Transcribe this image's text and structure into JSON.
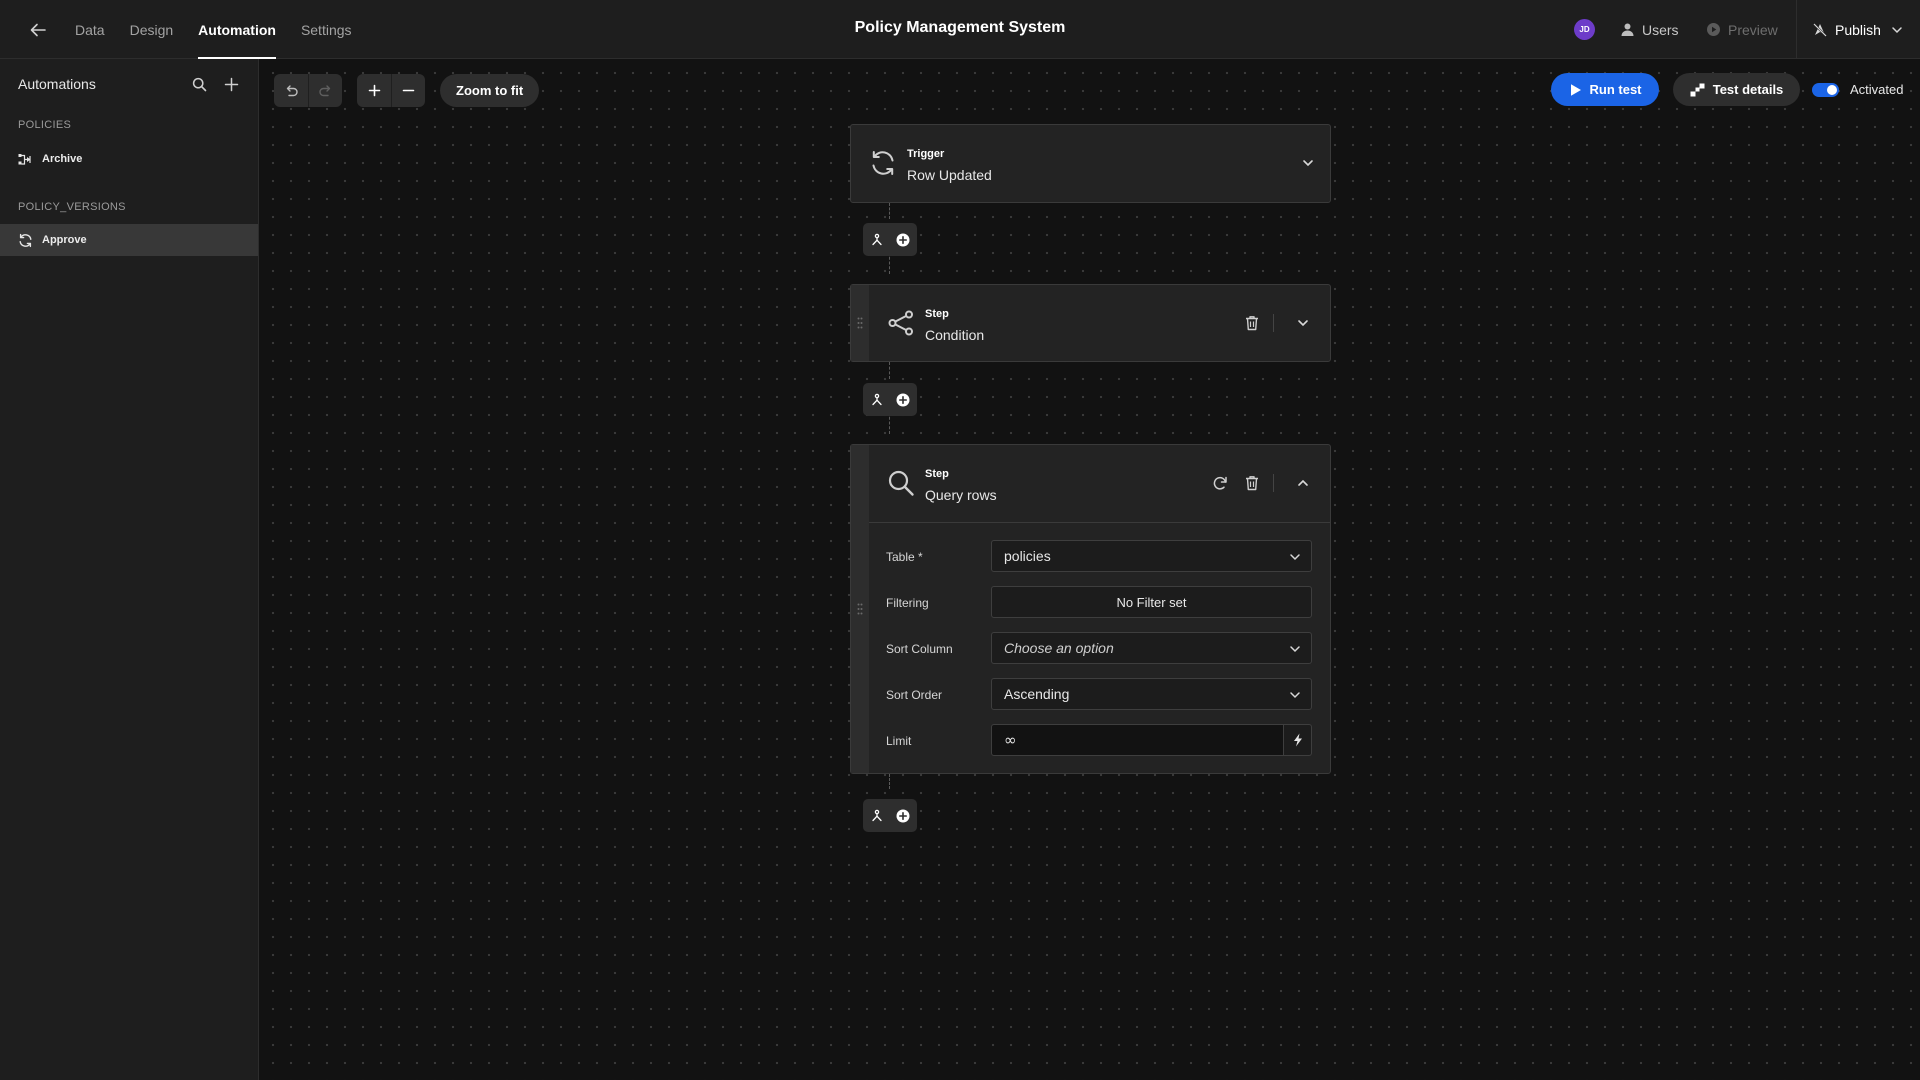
{
  "topbar": {
    "tabs": [
      {
        "label": "Data"
      },
      {
        "label": "Design"
      },
      {
        "label": "Automation",
        "active": true
      },
      {
        "label": "Settings"
      }
    ],
    "title": "Policy Management System",
    "avatar_initials": "JD",
    "users_label": "Users",
    "preview_label": "Preview",
    "publish_label": "Publish"
  },
  "sidebar": {
    "heading": "Automations",
    "groups": [
      {
        "label": "POLICIES",
        "items": [
          {
            "label": "Archive",
            "icon": "app-action-icon"
          }
        ]
      },
      {
        "label": "POLICY_VERSIONS",
        "items": [
          {
            "label": "Approve",
            "icon": "refresh-icon",
            "selected": true
          }
        ]
      }
    ]
  },
  "toolbar": {
    "zoom_to_fit_label": "Zoom to fit",
    "run_test_label": "Run test",
    "test_details_label": "Test details",
    "activated_label": "Activated",
    "activated": true
  },
  "flow": {
    "trigger": {
      "kind": "Trigger",
      "name": "Row Updated"
    },
    "condition": {
      "kind": "Step",
      "name": "Condition"
    },
    "query": {
      "kind": "Step",
      "name": "Query rows",
      "fields": {
        "table_label": "Table *",
        "table_value": "policies",
        "filtering_label": "Filtering",
        "filtering_value": "No Filter set",
        "sort_column_label": "Sort Column",
        "sort_column_placeholder": "Choose an option",
        "sort_order_label": "Sort Order",
        "sort_order_value": "Ascending",
        "limit_label": "Limit",
        "limit_value": "∞"
      }
    }
  },
  "colors": {
    "accent": "#1b64e6",
    "avatar": "#6d3cc9"
  }
}
